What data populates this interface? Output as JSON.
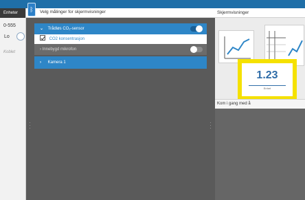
{
  "left": {
    "header": "Enheter",
    "value": "0-555",
    "toggle_label": "Lo",
    "sub_label": "Koblet"
  },
  "middle": {
    "header_title": "Velg målinger for skjermvisninger",
    "sensors": [
      {
        "name": "Trådløs CO₂-sensor",
        "enabled": true,
        "measurements": [
          {
            "label": "CO2 konsentrasjon",
            "checked": true
          }
        ]
      },
      {
        "name": "Innebygd mikrofon",
        "enabled": false,
        "measurements": []
      }
    ],
    "camera_label": "Kamera 1"
  },
  "right": {
    "header_title": "Skjermvisninger",
    "lower_label": "Kom i gang med å",
    "meter_value": "1.23",
    "meter_unit": "Enhet"
  },
  "colors": {
    "accent_blue": "#2e86c7",
    "highlight_yellow": "#f5e100",
    "panel_gray": "#5a5a5a"
  },
  "icons": {
    "bluetooth": "bluetooth-icon",
    "graph": "line-graph-icon",
    "table": "table-icon",
    "meter": "digital-meter-icon"
  }
}
